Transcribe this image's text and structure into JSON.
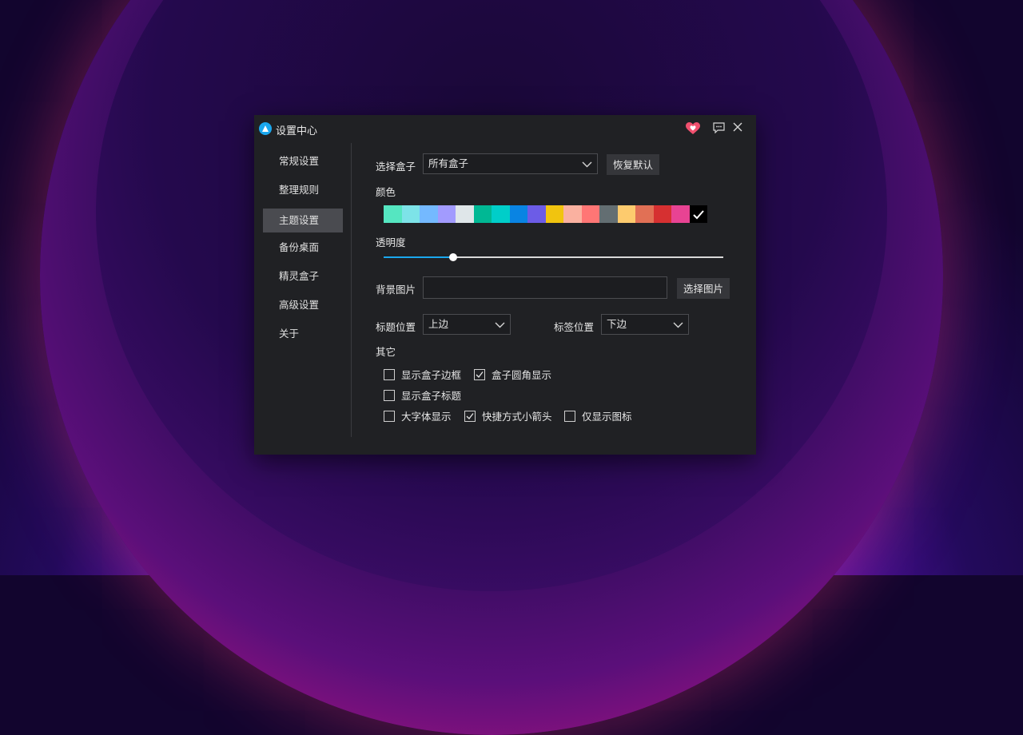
{
  "window": {
    "title": "设置中心",
    "icons": {
      "logo": "app-logo-icon",
      "heart": "heart-icon",
      "feedback": "comment-icon",
      "close": "close-icon"
    }
  },
  "sidebar": {
    "items": [
      {
        "label": "常规设置",
        "active": false
      },
      {
        "label": "整理规则",
        "active": false
      },
      {
        "label": "主题设置",
        "active": true
      },
      {
        "label": "备份桌面",
        "active": false
      },
      {
        "label": "精灵盒子",
        "active": false
      },
      {
        "label": "高级设置",
        "active": false
      },
      {
        "label": "关于",
        "active": false
      }
    ]
  },
  "theme": {
    "box_select": {
      "label": "选择盒子",
      "value": "所有盒子"
    },
    "reset_button": "恢复默认",
    "color": {
      "label": "颜色",
      "swatches": [
        "#55e6c1",
        "#7de3e8",
        "#74b9ff",
        "#a29bfe",
        "#dfe6e9",
        "#00b894",
        "#00cec9",
        "#0984e3",
        "#6c5ce7",
        "#f1c40f",
        "#fab1a0",
        "#ff7675",
        "#636e72",
        "#fdcb6e",
        "#e17055",
        "#d63031",
        "#e84393",
        "#000000"
      ],
      "selected_index": 17
    },
    "opacity": {
      "label": "透明度",
      "value": 0.205
    },
    "background": {
      "label": "背景图片",
      "value": "",
      "button": "选择图片"
    },
    "title_position": {
      "label": "标题位置",
      "value": "上边"
    },
    "tab_position": {
      "label": "标签位置",
      "value": "下边"
    },
    "other": {
      "label": "其它",
      "options": [
        {
          "label": "显示盒子边框",
          "checked": false
        },
        {
          "label": "盒子圆角显示",
          "checked": true
        },
        {
          "label": "显示盒子标题",
          "checked": false
        },
        {
          "label": "大字体显示",
          "checked": false
        },
        {
          "label": "快捷方式小箭头",
          "checked": true
        },
        {
          "label": "仅显示图标",
          "checked": false
        }
      ]
    }
  }
}
